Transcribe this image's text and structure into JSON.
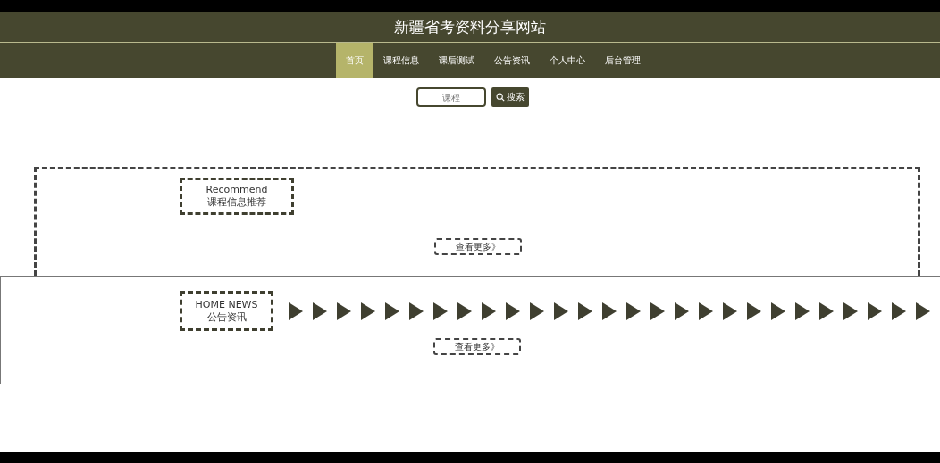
{
  "site_title": "新疆省考资料分享网站",
  "nav": [
    {
      "label": "首页",
      "selected": true
    },
    {
      "label": "课程信息",
      "selected": false
    },
    {
      "label": "课后测试",
      "selected": false
    },
    {
      "label": "公告资讯",
      "selected": false
    },
    {
      "label": "个人中心",
      "selected": false
    },
    {
      "label": "后台管理",
      "selected": false
    }
  ],
  "search": {
    "placeholder": "课程",
    "button": "搜索"
  },
  "sections": [
    {
      "title_en": "Recommend",
      "title_cn": "课程信息推荐",
      "more": "查看更多》"
    },
    {
      "title_en": "HOME NEWS",
      "title_cn": "公告资讯",
      "more": "查看更多》"
    }
  ]
}
